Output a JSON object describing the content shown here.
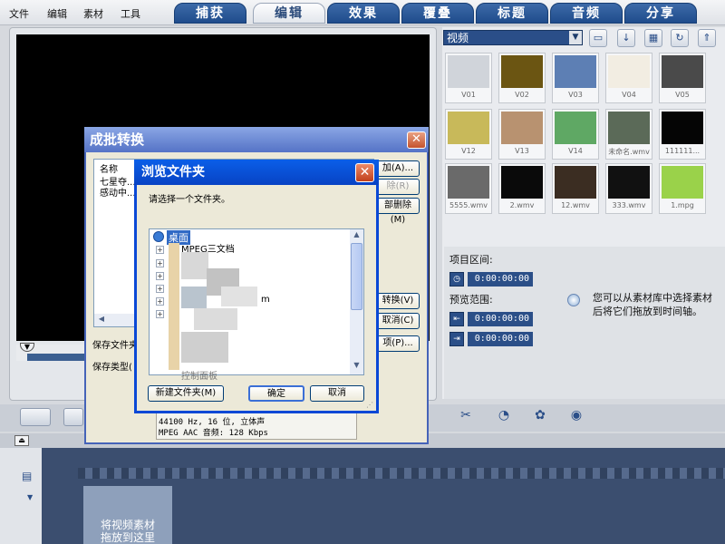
{
  "menu": [
    "文件",
    "编辑",
    "素材",
    "工具"
  ],
  "tabs": [
    {
      "label": "捕获",
      "active": false
    },
    {
      "label": "编辑",
      "active": true
    },
    {
      "label": "效果",
      "active": false
    },
    {
      "label": "覆叠",
      "active": false
    },
    {
      "label": "标题",
      "active": false
    },
    {
      "label": "音频",
      "active": false
    },
    {
      "label": "分享",
      "active": false
    }
  ],
  "library": {
    "category": "视频",
    "thumbnails": [
      {
        "label": "V01",
        "color": "#d0d4da"
      },
      {
        "label": "V02",
        "color": "#6b5512"
      },
      {
        "label": "V03",
        "color": "#5d7fb4"
      },
      {
        "label": "V04",
        "color": "#f2ede2"
      },
      {
        "label": "V05",
        "color": "#4a4a4a"
      },
      {
        "label": "V12",
        "color": "#c8b95a"
      },
      {
        "label": "V13",
        "color": "#b89270"
      },
      {
        "label": "V14",
        "color": "#5fa864"
      },
      {
        "label": "未命名.wmv",
        "color": "#5b6a58"
      },
      {
        "label": "111111...",
        "color": "#050505"
      },
      {
        "label": "5555.wmv",
        "color": "#6a6a6a"
      },
      {
        "label": "2.wmv",
        "color": "#0a0a0a"
      },
      {
        "label": "12.wmv",
        "color": "#3b2d22"
      },
      {
        "label": "333.wmv",
        "color": "#111111"
      },
      {
        "label": "1.mpg",
        "color": "#9ad24a"
      }
    ]
  },
  "range": {
    "project_label": "项目区间:",
    "project_time": "0:00:00:00",
    "preview_label": "预览范围:",
    "preview_start": "0:00:00:00",
    "preview_end": "0:00:00:00",
    "hint_line1": "您可以从素材库中选择素材",
    "hint_line2": "后将它们拖放到时间轴。"
  },
  "timeline": {
    "drop_hint_line1": "将视频素材",
    "drop_hint_line2": "拖放到这里"
  },
  "batch_dialog": {
    "title": "成批转换",
    "list_header": "名称",
    "files": [
      "七星夺...",
      "感动中..."
    ],
    "add_button": "加(A)...",
    "remove_button": "除(R)",
    "remove_all_button": "部删除(M)",
    "convert_button": "转换(V)",
    "cancel_button": "取消(C)",
    "options_button": "项(P)...",
    "save_folder_label": "保存文件夹",
    "save_type_label": "保存类型(",
    "info_line1": "44100 Hz, 16 位, 立体声",
    "info_line2": "MPEG AAC 音频: 128 Kbps"
  },
  "browse_dialog": {
    "title": "浏览文件夹",
    "prompt": "请选择一个文件夹。",
    "root_node": "桌面",
    "node_partial_1": "MPEG三文档",
    "node_partial_2": "m",
    "node_partial_3": "控制面板",
    "new_folder_button": "新建文件夹(M)",
    "ok_button": "确定",
    "cancel_button": "取消"
  },
  "colors": {
    "accent_blue": "#1f4c8c",
    "xp_title": "#0a48d6",
    "timeline_bg": "#3b4e6f"
  }
}
